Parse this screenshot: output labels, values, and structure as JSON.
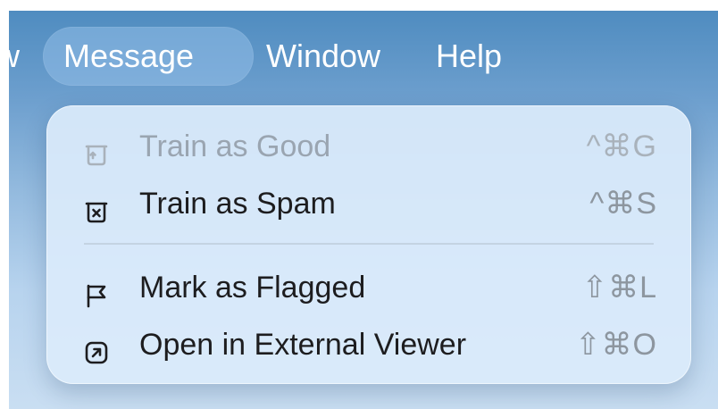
{
  "menubar": {
    "items": [
      {
        "label": "w"
      },
      {
        "label": "Message"
      },
      {
        "label": "Window"
      },
      {
        "label": "Help"
      }
    ]
  },
  "dropdown": {
    "items": [
      {
        "label": "Train as Good",
        "shortcut": "^⌘G",
        "icon": "tray-up-icon",
        "enabled": false
      },
      {
        "label": "Train as Spam",
        "shortcut": "^⌘S",
        "icon": "tray-x-icon",
        "enabled": true
      },
      {
        "label": "Mark as Flagged",
        "shortcut": "⇧⌘L",
        "icon": "flag-icon",
        "enabled": true
      },
      {
        "label": "Open in External Viewer",
        "shortcut": "⇧⌘O",
        "icon": "external-arrow-icon",
        "enabled": true
      }
    ]
  },
  "colors": {
    "menubar_text": "#ffffff",
    "menu_text": "#1d1d1f",
    "disabled_text": "#9aa5b1",
    "shortcut_text": "#8d969f",
    "active_highlight": "#91bee8"
  }
}
